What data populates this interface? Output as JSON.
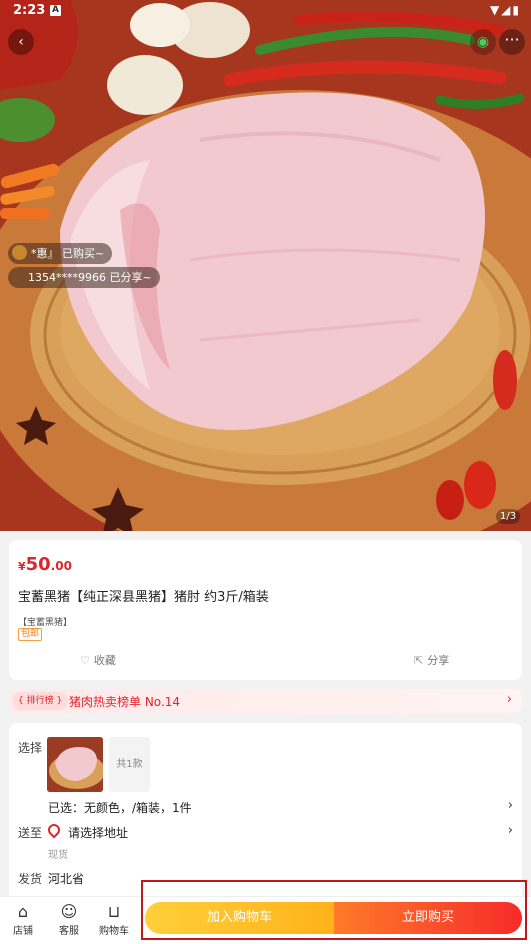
{
  "status_bar": {
    "time": "2:23",
    "notif": "A",
    "icons": "▼◢▮"
  },
  "header": {
    "back_icon": "‹",
    "wechat_icon": "◉",
    "more_icon": "···"
  },
  "hero": {
    "buyer_bubble": "*惠』 已购买~",
    "share_bubble": "1354****9966 已分享~",
    "pager": "1/3"
  },
  "product": {
    "price_currency": "¥",
    "price_int": "50",
    "price_dec": ".00",
    "title": "宝蓄黑猪【纯正深县黑猪】猪肘 约3斤/箱装",
    "brand": "【宝蓄黑猪】",
    "ship_tag": "包邮",
    "favorite_label": "收藏",
    "share_label": "分享"
  },
  "rank": {
    "badge": "{ 排行榜 }",
    "text": "猪肉热卖榜单 No.14",
    "chevron": "›"
  },
  "options": {
    "select_label": "选择",
    "count": "共1款",
    "selected": "已选：无颜色，/箱装，1件",
    "deliver_label": "送至",
    "address": "请选择地址",
    "stock": "现货",
    "ship_label": "发货",
    "origin": "河北省"
  },
  "bottom_bar": {
    "store": "店铺",
    "service": "客服",
    "cart": "购物车",
    "add_to_cart": "加入购物车",
    "buy_now": "立即购买"
  },
  "colors": {
    "price": "#e0262c",
    "cart_button": "#ffb21a",
    "buy_button": "#f62b2b",
    "highlight_frame": "#c01818"
  }
}
